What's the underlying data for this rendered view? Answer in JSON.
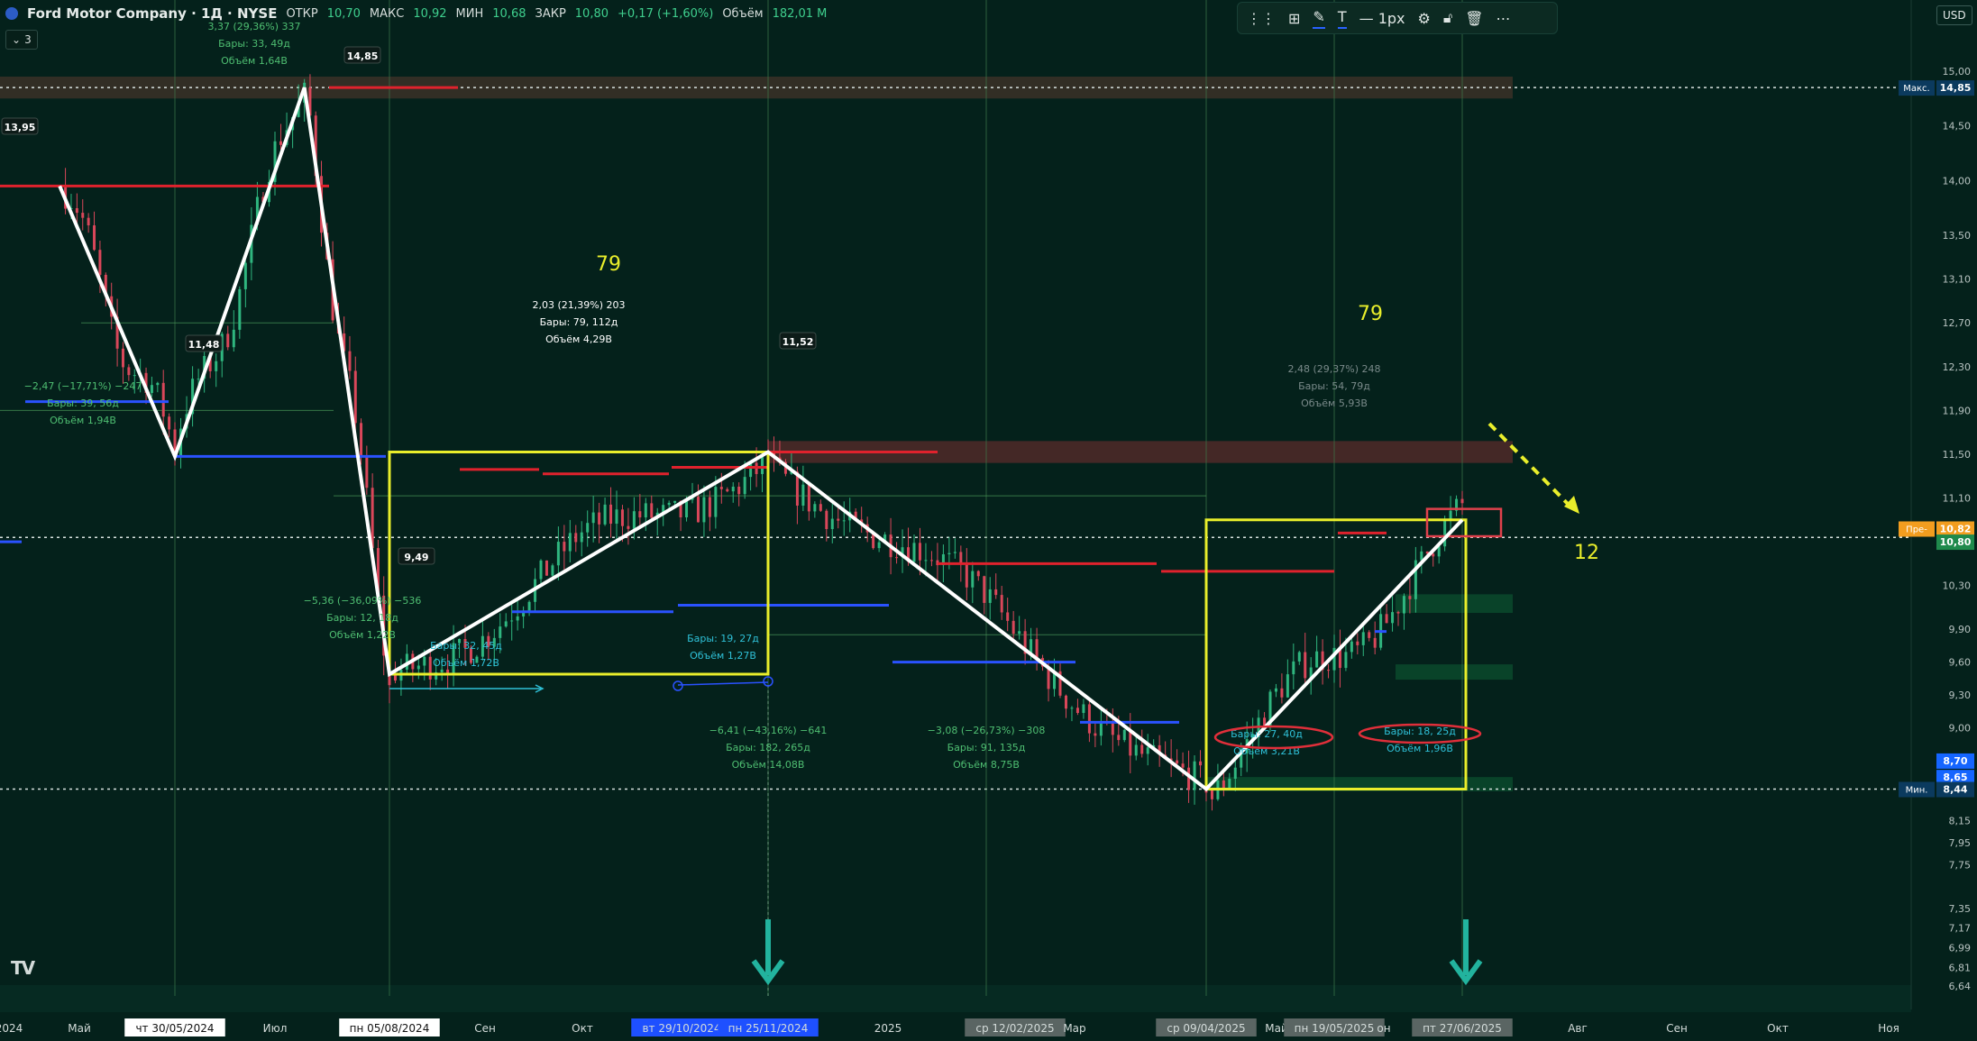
{
  "header": {
    "title": "Ford Motor Company · 1Д · NYSE",
    "open_label": "ОТКР",
    "open_value": "10,70",
    "high_label": "МАКС",
    "high_value": "10,92",
    "low_label": "МИН",
    "low_value": "10,68",
    "close_label": "ЗАКР",
    "close_value": "10,80",
    "change_value": "+0,17 (+1,60%)",
    "volume_label": "Объём",
    "volume_value": "182,01 M",
    "collapse_label": "3"
  },
  "toolbar": {
    "width_label": "1px",
    "icons": [
      "drag-handle-icon",
      "layout-icon",
      "pencil-icon",
      "text-icon",
      "line-style-icon",
      "settings-icon",
      "lock-icon",
      "trash-icon",
      "more-icon"
    ]
  },
  "currency": "USD",
  "colors": {
    "background": "#04211b",
    "up_candle": "#2fb67f",
    "down_candle": "#d9475a",
    "zigzag": "#ffffff",
    "range_box": "#e9ee2b",
    "resistance": "#e0222d",
    "support": "#2a52ff",
    "annotation_text": "#e9ee2b",
    "forecast_arrow": "#e9ee2b",
    "down_arrow": "#22b39e",
    "ellipse": "#e02f3a"
  },
  "chart_data": {
    "type": "candlestick",
    "symbol": "Ford Motor Company · 1Д · NYSE",
    "y_range": [
      6.55,
      15.65
    ],
    "y_ticks": [
      "15,50",
      "15,00",
      "14,50",
      "14,00",
      "13,50",
      "13,10",
      "12,70",
      "12,30",
      "11,90",
      "11,50",
      "11,10",
      "10,70",
      "10,30",
      "9,90",
      "9,60",
      "9,30",
      "9,00",
      "8,15",
      "7,95",
      "7,75",
      "7,35",
      "7,17",
      "6,99",
      "6,81",
      "6,64"
    ],
    "price_tags": [
      {
        "label": "Макс.",
        "value": "14,85",
        "price": 14.85,
        "color": "#0b3a5e"
      },
      {
        "label": "Пре-",
        "value": "10,82",
        "price": 10.82,
        "color": "#f29d1f"
      },
      {
        "label": "",
        "value": "10,80",
        "price": 10.7,
        "color": "#1f8a4c"
      },
      {
        "label": "",
        "value": "8,70",
        "price": 8.7,
        "color": "#1565ff"
      },
      {
        "label": "",
        "value": "8,65",
        "price": 8.55,
        "color": "#1565ff"
      },
      {
        "label": "Мин.",
        "value": "8,44",
        "price": 8.44,
        "color": "#0b3a5e"
      }
    ],
    "x_labels": [
      {
        "text": "2024",
        "highlight": "none"
      },
      {
        "text": "Май",
        "highlight": "none"
      },
      {
        "text": "чт 30/05/2024",
        "highlight": "white"
      },
      {
        "text": "Июл",
        "highlight": "none"
      },
      {
        "text": "пн 05/08/2024",
        "highlight": "white"
      },
      {
        "text": "Сен",
        "highlight": "none"
      },
      {
        "text": "Окт",
        "highlight": "none"
      },
      {
        "text": "вт 29/10/2024",
        "highlight": "blue"
      },
      {
        "text": "пн 25/11/2024",
        "highlight": "blue"
      },
      {
        "text": "2025",
        "highlight": "none"
      },
      {
        "text": "ср 12/02/2025",
        "highlight": "gray"
      },
      {
        "text": "Мар",
        "highlight": "none"
      },
      {
        "text": "ср 09/04/2025",
        "highlight": "gray"
      },
      {
        "text": "Май",
        "highlight": "none"
      },
      {
        "text": "пн 19/05/2025",
        "highlight": "gray"
      },
      {
        "text": "он",
        "highlight": "none"
      },
      {
        "text": "пт 27/06/2025",
        "highlight": "gray"
      },
      {
        "text": "Авг",
        "highlight": "none"
      },
      {
        "text": "Сен",
        "highlight": "none"
      },
      {
        "text": "Окт",
        "highlight": "none"
      },
      {
        "text": "Ноя",
        "highlight": "none"
      }
    ],
    "zigzag": [
      {
        "date": "2024-04",
        "price": 13.95
      },
      {
        "date": "2024-05-30",
        "price": 11.48
      },
      {
        "date": "2024-07-10",
        "price": 14.85
      },
      {
        "date": "2024-08-05",
        "price": 9.49
      },
      {
        "date": "2024-11-25",
        "price": 11.52
      },
      {
        "date": "2025-04-09",
        "price": 8.44
      },
      {
        "date": "2025-06-27",
        "price": 10.9
      }
    ],
    "pivot_labels": [
      "13,95",
      "11,48",
      "14,85",
      "9,49",
      "11,52"
    ],
    "range_boxes": [
      {
        "from": "2024-08-05",
        "to": "2024-11-25",
        "low": 9.49,
        "high": 11.52,
        "bars_count": "79"
      },
      {
        "from": "2025-04-09",
        "to": "2025-06-27",
        "low": 8.44,
        "high": 10.9,
        "bars_count": "79"
      }
    ],
    "measurements": [
      {
        "lines": [
          "3,37 (29,36%) 337",
          "Бары: 33, 49д",
          "Объём 1,64B"
        ]
      },
      {
        "lines": [
          "−2,47 (−17,71%) −247",
          "Бары: 39, 56д",
          "Объём 1,94B"
        ]
      },
      {
        "lines": [
          "−5,36 (−36,09%) −536",
          "Бары: 12, 18д",
          "Объём 1,22B"
        ]
      },
      {
        "lines": [
          "2,03 (21,39%) 203",
          "Бары: 79, 112д",
          "Объём 4,29B"
        ]
      },
      {
        "lines": [
          "Бары: 32, 45д",
          "Объём 1,72B"
        ]
      },
      {
        "lines": [
          "Бары: 19, 27д",
          "Объём 1,27B"
        ]
      },
      {
        "lines": [
          "−6,41 (−43,16%) −641",
          "Бары: 182, 265д",
          "Объём 14,08B"
        ]
      },
      {
        "lines": [
          "−3,08 (−26,73%) −308",
          "Бары: 91, 135д",
          "Объём 8,75B"
        ]
      },
      {
        "lines": [
          "2,48 (29,37%) 248",
          "Бары: 54, 79д",
          "Объём 5,93B"
        ]
      },
      {
        "lines": [
          "Бары: 27, 40д",
          "Объём 3,21B"
        ]
      },
      {
        "lines": [
          "Бары: 18, 25д",
          "Объём 1,96B"
        ]
      }
    ],
    "forecast_label": "12",
    "grid": false,
    "legend": "none"
  }
}
